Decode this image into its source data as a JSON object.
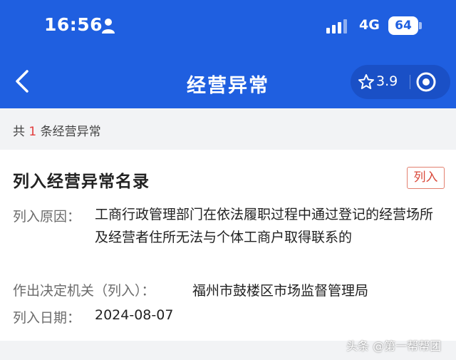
{
  "status_bar": {
    "time": "16:56",
    "network": "4G",
    "battery": "64"
  },
  "nav": {
    "title": "经营异常",
    "rating": "3.9"
  },
  "summary": {
    "prefix": "共 ",
    "count": "1",
    "suffix": " 条经营异常"
  },
  "record": {
    "title": "列入经营异常名录",
    "tag": "列入",
    "reason_label": "列入原因：",
    "reason_value": "工商行政管理部门在依法履职过程中通过登记的经营场所及经营者住所无法与个体工商户取得联系的",
    "authority_label": "作出决定机关（列入）：",
    "authority_value": "福州市鼓楼区市场监督管理局",
    "date_label": "列入日期：",
    "date_value": "2024-08-07"
  },
  "watermark": "头条 @第一帮帮团",
  "colors": {
    "primary": "#1f5fe0",
    "accent_red": "#e23c3c",
    "background": "#f2f3f5"
  },
  "icons": [
    "person-icon",
    "signal-icon",
    "back-icon",
    "star-icon",
    "target-icon"
  ]
}
